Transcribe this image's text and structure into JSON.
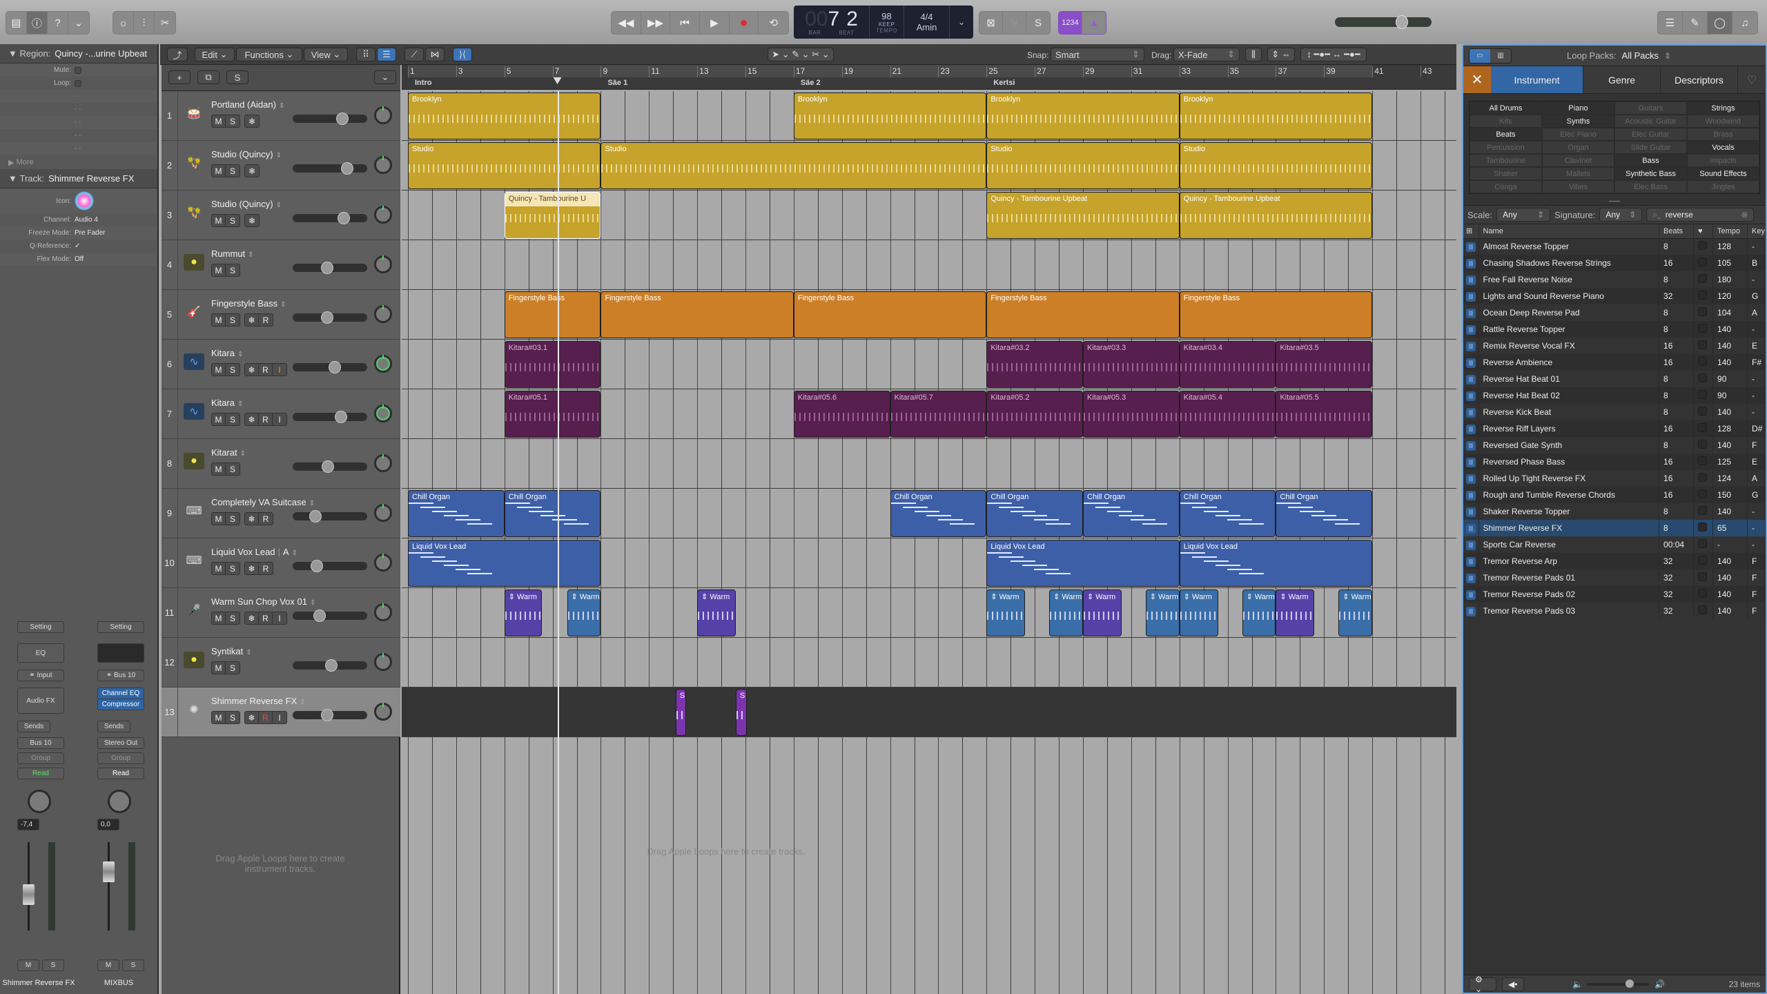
{
  "toolbar": {
    "left_icons": [
      "library-icon",
      "info-icon",
      "help-icon",
      "toolbar-menu-icon"
    ],
    "edit_icons": [
      "smart-controls-icon",
      "mixer-icon",
      "editors-scissors-icon"
    ],
    "transport": [
      "rewind",
      "fast-forward",
      "go-to-start",
      "play",
      "record",
      "cycle"
    ],
    "lcd": {
      "bar_prefix": "00",
      "bar": "7",
      "beat": "2",
      "bar_label": "BAR",
      "beat_label": "BEAT",
      "tempo": "98",
      "tempo_mode": "KEEP",
      "tempo_label": "TEMPO",
      "signature": "4/4",
      "key": "Amin"
    },
    "modes": {
      "count_in": "1234"
    },
    "master_volume": 0.68,
    "right_icons": [
      "list-editors-icon",
      "notepad-icon",
      "loop-browser-icon",
      "media-browser-icon"
    ]
  },
  "inspector": {
    "region_label": "Region:",
    "region_name": "Quincy  -...urine Upbeat",
    "region_rows": [
      {
        "label": "Mute:",
        "type": "checkbox"
      },
      {
        "label": "Loop:",
        "type": "checkbox"
      },
      {
        "label": "",
        "value": "- -"
      },
      {
        "label": "",
        "value": "- -"
      },
      {
        "label": "",
        "value": "- -"
      },
      {
        "label": "",
        "value": "- -"
      },
      {
        "label": "",
        "value": "- -"
      }
    ],
    "more_label": "More",
    "track_label": "Track:",
    "track_name": "Shimmer Reverse FX",
    "track_rows": [
      {
        "label": "Icon:",
        "value": ""
      },
      {
        "label": "Channel:",
        "value": "Audio 4"
      },
      {
        "label": "Freeze Mode:",
        "value": "Pre Fader"
      },
      {
        "label": "Q-Reference:",
        "value": "✓"
      },
      {
        "label": "Flex Mode:",
        "value": "Off"
      }
    ],
    "strips": [
      {
        "name": "Shimmer Reverse FX",
        "setting": "Setting",
        "eq": "EQ",
        "input": "Input",
        "fx": [
          "Audio FX"
        ],
        "sends": "Sends",
        "output": "Bus 10",
        "group": "Group",
        "automation": "Read",
        "automation_color": "#5ee06e",
        "volume": "-7,4",
        "fader": 0.45
      },
      {
        "name": "MIXBUS",
        "setting": "Setting",
        "eq": "",
        "input": "Bus 10",
        "fx": [
          "Channel EQ",
          "Compressor"
        ],
        "sends": "Sends",
        "output": "Stereo Out",
        "group": "Group",
        "automation": "Read",
        "automation_color": "#ffffff",
        "volume": "0,0",
        "fader": 0.75
      }
    ]
  },
  "tracks_toolbar": {
    "edit": "Edit",
    "functions": "Functions",
    "view": "View",
    "snap_label": "Snap:",
    "snap": "Smart",
    "drag_label": "Drag:",
    "drag": "X-Fade"
  },
  "ruler": {
    "bars": [
      "1",
      "3",
      "5",
      "7",
      "9",
      "11",
      "13",
      "15",
      "17",
      "19",
      "21",
      "23",
      "25",
      "27",
      "29",
      "31",
      "33",
      "35",
      "37",
      "39",
      "41",
      "43"
    ],
    "markers": [
      {
        "name": "Intro",
        "bar": 1
      },
      {
        "name": "Säe 1",
        "bar": 9
      },
      {
        "name": "Säe 2",
        "bar": 17
      },
      {
        "name": "Kertsi",
        "bar": 25
      }
    ],
    "playhead_bar": 7.2,
    "cycle": [
      1,
      41
    ]
  },
  "tracks": [
    {
      "num": "1",
      "name": "Portland (Aidan)",
      "icon": "drum-kit-icon",
      "glyph": "🥁",
      "buttons": [
        "M",
        "S"
      ],
      "extra": [
        "❄"
      ],
      "volume": 0.7,
      "pan": 0
    },
    {
      "num": "2",
      "name": "Studio (Quincy)",
      "icon": "maracas-icon",
      "glyph": "🪇",
      "buttons": [
        "M",
        "S"
      ],
      "extra": [
        "❄"
      ],
      "volume": 0.78,
      "pan": 0
    },
    {
      "num": "3",
      "name": "Studio (Quincy)",
      "icon": "maracas-icon",
      "glyph": "🪇",
      "buttons": [
        "M",
        "S"
      ],
      "extra": [
        "❄"
      ],
      "volume": 0.72,
      "pan": 0
    },
    {
      "num": "4",
      "name": "Rummut",
      "icon": "drummer-icon",
      "glyph": "●",
      "buttons": [
        "M",
        "S"
      ],
      "extra": [],
      "volume": 0.45,
      "pan": 0
    },
    {
      "num": "5",
      "name": "Fingerstyle Bass",
      "icon": "bass-guitar-icon",
      "glyph": "🎸",
      "buttons": [
        "M",
        "S"
      ],
      "extra": [
        "❄",
        "R"
      ],
      "volume": 0.45,
      "pan": 0
    },
    {
      "num": "6",
      "name": "Kitara",
      "icon": "audio-waveform-icon",
      "glyph": "∿",
      "buttons": [
        "M",
        "S"
      ],
      "extra": [
        "❄",
        "R",
        "I"
      ],
      "volume": 0.58,
      "pan": -0.6
    },
    {
      "num": "7",
      "name": "Kitara",
      "icon": "audio-waveform-icon",
      "glyph": "∿",
      "buttons": [
        "M",
        "S"
      ],
      "extra": [
        "❄",
        "R",
        "I"
      ],
      "volume": 0.68,
      "pan": 0.6
    },
    {
      "num": "8",
      "name": "Kitarat",
      "icon": "drummer-icon",
      "glyph": "●",
      "buttons": [
        "M",
        "S"
      ],
      "extra": [],
      "volume": 0.47,
      "pan": 0
    },
    {
      "num": "9",
      "name": "Completely VA Suitcase",
      "icon": "keyboard-stand-icon",
      "glyph": "⌨",
      "buttons": [
        "M",
        "S"
      ],
      "extra": [
        "❄",
        "R"
      ],
      "volume": 0.27,
      "pan": 0
    },
    {
      "num": "10",
      "name": "Liquid Vox Lead",
      "name_suffix": "A",
      "icon": "keyboard-stand-icon",
      "glyph": "⌨",
      "buttons": [
        "M",
        "S"
      ],
      "extra": [
        "❄",
        "R"
      ],
      "volume": 0.29,
      "pan": 0
    },
    {
      "num": "11",
      "name": "Warm Sun Chop Vox 01",
      "icon": "microphone-icon",
      "glyph": "🎤",
      "buttons": [
        "M",
        "S"
      ],
      "extra": [
        "❄",
        "R",
        "I"
      ],
      "volume": 0.33,
      "pan": 0
    },
    {
      "num": "12",
      "name": "Syntikat",
      "icon": "drummer-icon",
      "glyph": "●",
      "buttons": [
        "M",
        "S"
      ],
      "extra": [],
      "volume": 0.52,
      "pan": 0
    },
    {
      "num": "13",
      "name": "Shimmer Reverse FX",
      "icon": "shimmer-icon",
      "glyph": "✺",
      "buttons": [
        "M",
        "S"
      ],
      "extra": [
        "❄",
        "R",
        "I"
      ],
      "volume": 0.45,
      "pan": 0,
      "selected": true
    }
  ],
  "regions": [
    {
      "track": 0,
      "name": "Brooklyn",
      "start": 1,
      "end": 9,
      "color": "#c6a32a",
      "kind": "audio"
    },
    {
      "track": 0,
      "name": "Brooklyn",
      "start": 17,
      "end": 25,
      "color": "#c6a32a",
      "kind": "audio"
    },
    {
      "track": 0,
      "name": "Brooklyn",
      "start": 25,
      "end": 33,
      "color": "#c6a32a",
      "kind": "audio"
    },
    {
      "track": 0,
      "name": "Brooklyn",
      "start": 33,
      "end": 41,
      "color": "#c6a32a",
      "kind": "audio"
    },
    {
      "track": 1,
      "name": "Studio",
      "start": 1,
      "end": 9,
      "color": "#c6a32a",
      "kind": "audio"
    },
    {
      "track": 1,
      "name": "Studio",
      "start": 9,
      "end": 25,
      "color": "#c6a32a",
      "kind": "audio"
    },
    {
      "track": 1,
      "name": "Studio",
      "start": 25,
      "end": 33,
      "color": "#c6a32a",
      "kind": "audio"
    },
    {
      "track": 1,
      "name": "Studio",
      "start": 33,
      "end": 41,
      "color": "#c6a32a",
      "kind": "audio"
    },
    {
      "track": 2,
      "name": "Quincy  -  Tambourine U",
      "start": 5,
      "end": 9,
      "color": "#c6a32a",
      "kind": "audio",
      "selected": true
    },
    {
      "track": 2,
      "name": "Quincy  -  Tambourine Upbeat",
      "start": 25,
      "end": 33,
      "color": "#c6a32a",
      "kind": "audio"
    },
    {
      "track": 2,
      "name": "Quincy  -  Tambourine Upbeat",
      "start": 33,
      "end": 41,
      "color": "#c6a32a",
      "kind": "audio"
    },
    {
      "track": 4,
      "name": "Fingerstyle Bass",
      "start": 5,
      "end": 9,
      "color": "#cc7f27",
      "kind": "midi"
    },
    {
      "track": 4,
      "name": "Fingerstyle Bass",
      "start": 9,
      "end": 17,
      "color": "#cc7f27",
      "kind": "midi"
    },
    {
      "track": 4,
      "name": "Fingerstyle Bass",
      "start": 17,
      "end": 25,
      "color": "#cc7f27",
      "kind": "midi"
    },
    {
      "track": 4,
      "name": "Fingerstyle Bass",
      "start": 25,
      "end": 33,
      "color": "#cc7f27",
      "kind": "midi"
    },
    {
      "track": 4,
      "name": "Fingerstyle Bass",
      "start": 33,
      "end": 41,
      "color": "#cc7f27",
      "kind": "midi"
    },
    {
      "track": 5,
      "name": "Kitara#03.1",
      "start": 5,
      "end": 9,
      "color": "#561f4e",
      "kind": "audio"
    },
    {
      "track": 5,
      "name": "Kitara#03.2",
      "start": 25,
      "end": 29,
      "color": "#561f4e",
      "kind": "audio"
    },
    {
      "track": 5,
      "name": "Kitara#03.3",
      "start": 29,
      "end": 33,
      "color": "#561f4e",
      "kind": "audio"
    },
    {
      "track": 5,
      "name": "Kitara#03.4",
      "start": 33,
      "end": 37,
      "color": "#561f4e",
      "kind": "audio"
    },
    {
      "track": 5,
      "name": "Kitara#03.5",
      "start": 37,
      "end": 41,
      "color": "#561f4e",
      "kind": "audio"
    },
    {
      "track": 6,
      "name": "Kitara#05.1",
      "start": 5,
      "end": 9,
      "color": "#561f4e",
      "kind": "audio"
    },
    {
      "track": 6,
      "name": "Kitara#05.6",
      "start": 17,
      "end": 21,
      "color": "#561f4e",
      "kind": "audio"
    },
    {
      "track": 6,
      "name": "Kitara#05.7",
      "start": 21,
      "end": 25,
      "color": "#561f4e",
      "kind": "audio"
    },
    {
      "track": 6,
      "name": "Kitara#05.2",
      "start": 25,
      "end": 29,
      "color": "#561f4e",
      "kind": "audio"
    },
    {
      "track": 6,
      "name": "Kitara#05.3",
      "start": 29,
      "end": 33,
      "color": "#561f4e",
      "kind": "audio"
    },
    {
      "track": 6,
      "name": "Kitara#05.4",
      "start": 33,
      "end": 37,
      "color": "#561f4e",
      "kind": "audio"
    },
    {
      "track": 6,
      "name": "Kitara#05.5",
      "start": 37,
      "end": 41,
      "color": "#561f4e",
      "kind": "audio"
    },
    {
      "track": 8,
      "name": "Chill Organ",
      "start": 1,
      "end": 5,
      "color": "#3d5fa8",
      "kind": "midi"
    },
    {
      "track": 8,
      "name": "Chill Organ",
      "start": 5,
      "end": 9,
      "color": "#3d5fa8",
      "kind": "midi"
    },
    {
      "track": 8,
      "name": "Chill Organ",
      "start": 21,
      "end": 25,
      "color": "#3d5fa8",
      "kind": "midi"
    },
    {
      "track": 8,
      "name": "Chill Organ",
      "start": 25,
      "end": 29,
      "color": "#3d5fa8",
      "kind": "midi"
    },
    {
      "track": 8,
      "name": "Chill Organ",
      "start": 29,
      "end": 33,
      "color": "#3d5fa8",
      "kind": "midi"
    },
    {
      "track": 8,
      "name": "Chill Organ",
      "start": 33,
      "end": 37,
      "color": "#3d5fa8",
      "kind": "midi"
    },
    {
      "track": 8,
      "name": "Chill Organ",
      "start": 37,
      "end": 41,
      "color": "#3d5fa8",
      "kind": "midi"
    },
    {
      "track": 9,
      "name": "Liquid Vox Lead",
      "start": 1,
      "end": 9,
      "color": "#3d5fa8",
      "kind": "midi"
    },
    {
      "track": 9,
      "name": "Liquid Vox Lead",
      "start": 25,
      "end": 33,
      "color": "#3d5fa8",
      "kind": "midi"
    },
    {
      "track": 9,
      "name": "Liquid Vox Lead",
      "start": 33,
      "end": 41,
      "color": "#3d5fa8",
      "kind": "midi"
    },
    {
      "track": 10,
      "name": "⇕ Warm",
      "start": 5,
      "end": 6.55,
      "color": "#5542a8",
      "kind": "audio"
    },
    {
      "track": 10,
      "name": "⇕ Warm",
      "start": 7.6,
      "end": 9,
      "color": "#3a6ea8",
      "kind": "audio"
    },
    {
      "track": 10,
      "name": "⇕ Warm",
      "start": 13,
      "end": 14.6,
      "color": "#5542a8",
      "kind": "audio"
    },
    {
      "track": 10,
      "name": "⇕ Warm",
      "start": 25,
      "end": 26.6,
      "color": "#3a6ea8",
      "kind": "audio"
    },
    {
      "track": 10,
      "name": "⇕ Warm",
      "start": 27.6,
      "end": 29,
      "color": "#3a6ea8",
      "kind": "audio"
    },
    {
      "track": 10,
      "name": "⇕ Warm",
      "start": 29,
      "end": 30.6,
      "color": "#5542a8",
      "kind": "audio"
    },
    {
      "track": 10,
      "name": "⇕ Warm",
      "start": 31.6,
      "end": 33,
      "color": "#3a6ea8",
      "kind": "audio"
    },
    {
      "track": 10,
      "name": "⇕ Warm",
      "start": 33,
      "end": 34.6,
      "color": "#3a6ea8",
      "kind": "audio"
    },
    {
      "track": 10,
      "name": "⇕ Warm",
      "start": 35.6,
      "end": 37,
      "color": "#3a6ea8",
      "kind": "audio"
    },
    {
      "track": 10,
      "name": "⇕ Warm",
      "start": 37,
      "end": 38.6,
      "color": "#5542a8",
      "kind": "audio"
    },
    {
      "track": 10,
      "name": "⇕ Warm",
      "start": 39.6,
      "end": 41,
      "color": "#3a6ea8",
      "kind": "audio"
    },
    {
      "track": 12,
      "name": "S",
      "start": 12.1,
      "end": 12.55,
      "color": "#7b34ad",
      "kind": "audio"
    },
    {
      "track": 12,
      "name": "S",
      "start": 14.6,
      "end": 15.05,
      "color": "#7b34ad",
      "kind": "audio"
    }
  ],
  "empty_hints": {
    "headers": "Drag Apple Loops here to create instrument tracks.",
    "arrange": "Drag Apple Loops here to create tracks."
  },
  "loop_browser": {
    "packs_label": "Loop Packs:",
    "packs_value": "All Packs",
    "tabs": [
      "Instrument",
      "Genre",
      "Descriptors"
    ],
    "active_tab": "Instrument",
    "keywords": [
      {
        "label": "All Drums",
        "on": true
      },
      {
        "label": "Piano",
        "on": true
      },
      {
        "label": "Guitars",
        "on": false
      },
      {
        "label": "Strings",
        "on": true
      },
      {
        "label": "Kits",
        "on": false
      },
      {
        "label": "Synths",
        "on": true
      },
      {
        "label": "Acoustic Guitar",
        "on": false
      },
      {
        "label": "Woodwind",
        "on": false
      },
      {
        "label": "Beats",
        "on": true
      },
      {
        "label": "Elec Piano",
        "on": false
      },
      {
        "label": "Elec Guitar",
        "on": false
      },
      {
        "label": "Brass",
        "on": false
      },
      {
        "label": "Percussion",
        "on": false
      },
      {
        "label": "Organ",
        "on": false
      },
      {
        "label": "Slide Guitar",
        "on": false
      },
      {
        "label": "Vocals",
        "on": true
      },
      {
        "label": "Tambourine",
        "on": false
      },
      {
        "label": "Clavinet",
        "on": false
      },
      {
        "label": "Bass",
        "on": true
      },
      {
        "label": "Impacts",
        "on": false
      },
      {
        "label": "Shaker",
        "on": false
      },
      {
        "label": "Mallets",
        "on": false
      },
      {
        "label": "Synthetic Bass",
        "on": true
      },
      {
        "label": "Sound Effects",
        "on": true
      },
      {
        "label": "Conga",
        "on": false
      },
      {
        "label": "Vibes",
        "on": false
      },
      {
        "label": "Elec Bass",
        "on": false
      },
      {
        "label": "Jingles",
        "on": false
      }
    ],
    "scale_label": "Scale:",
    "scale": "Any",
    "signature_label": "Signature:",
    "signature": "Any",
    "search_value": "reverse",
    "columns": [
      "Name",
      "Beats",
      "♥",
      "Tempo",
      "Key"
    ],
    "rows": [
      {
        "name": "Almost Reverse Topper",
        "beats": "8",
        "tempo": "128",
        "key": "-"
      },
      {
        "name": "Chasing Shadows Reverse Strings",
        "beats": "16",
        "tempo": "105",
        "key": "B"
      },
      {
        "name": "Free Fall Reverse Noise",
        "beats": "8",
        "tempo": "180",
        "key": "-"
      },
      {
        "name": "Lights and Sound Reverse Piano",
        "beats": "32",
        "tempo": "120",
        "key": "G"
      },
      {
        "name": "Ocean Deep Reverse Pad",
        "beats": "8",
        "tempo": "104",
        "key": "A"
      },
      {
        "name": "Rattle Reverse Topper",
        "beats": "8",
        "tempo": "140",
        "key": "-"
      },
      {
        "name": "Remix Reverse Vocal FX",
        "beats": "16",
        "tempo": "140",
        "key": "E"
      },
      {
        "name": "Reverse Ambience",
        "beats": "16",
        "tempo": "140",
        "key": "F#"
      },
      {
        "name": "Reverse Hat Beat 01",
        "beats": "8",
        "tempo": "90",
        "key": "-"
      },
      {
        "name": "Reverse Hat Beat 02",
        "beats": "8",
        "tempo": "90",
        "key": "-"
      },
      {
        "name": "Reverse Kick Beat",
        "beats": "8",
        "tempo": "140",
        "key": "-"
      },
      {
        "name": "Reverse Riff Layers",
        "beats": "16",
        "tempo": "128",
        "key": "D#"
      },
      {
        "name": "Reversed Gate Synth",
        "beats": "8",
        "tempo": "140",
        "key": "F"
      },
      {
        "name": "Reversed Phase Bass",
        "beats": "16",
        "tempo": "125",
        "key": "E"
      },
      {
        "name": "Rolled Up Tight Reverse FX",
        "beats": "16",
        "tempo": "124",
        "key": "A"
      },
      {
        "name": "Rough and Tumble Reverse Chords",
        "beats": "16",
        "tempo": "150",
        "key": "G"
      },
      {
        "name": "Shaker Reverse Topper",
        "beats": "8",
        "tempo": "140",
        "key": "-"
      },
      {
        "name": "Shimmer Reverse FX",
        "beats": "8",
        "tempo": "65",
        "key": "-",
        "selected": true
      },
      {
        "name": "Sports Car Reverse",
        "beats": "00:04",
        "tempo": "-",
        "key": "-"
      },
      {
        "name": "Tremor Reverse Arp",
        "beats": "32",
        "tempo": "140",
        "key": "F"
      },
      {
        "name": "Tremor Reverse Pads 01",
        "beats": "32",
        "tempo": "140",
        "key": "F"
      },
      {
        "name": "Tremor Reverse Pads 02",
        "beats": "32",
        "tempo": "140",
        "key": "F"
      },
      {
        "name": "Tremor Reverse Pads 03",
        "beats": "32",
        "tempo": "140",
        "key": "F"
      }
    ],
    "preview_volume": 0.7,
    "item_count": "23 items"
  }
}
